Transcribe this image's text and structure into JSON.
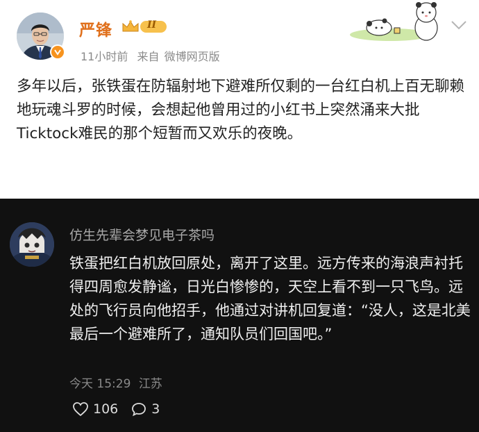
{
  "post": {
    "author": "严锋",
    "level_badge": "II",
    "time": "11小时前",
    "source_prefix": "来自",
    "source": "微博网页版",
    "text": "多年以后，张铁蛋在防辐射地下避难所仅剩的一台红白机上百无聊赖地玩魂斗罗的时候，会想起他曾用过的小红书上突然涌来大批Ticktock难民的那个短暂而又欢乐的夜晚。"
  },
  "comment": {
    "author": "仿生先辈会梦见电子茶吗",
    "text": "铁蛋把红白机放回原处，离开了这里。远方传来的海浪声衬托得四周愈发静谧，日光白惨惨的，天空上看不到一只飞鸟。远处的飞行员向他招手，他通过对讲机回复道：“没人，这是北美最后一个避难所了，通知队员们回国吧。”",
    "time": "今天 15:29",
    "location": "江苏",
    "likes": "106",
    "replies": "3"
  },
  "colors": {
    "author_orange": "#e0701c",
    "meta_gray": "#8a8a8a",
    "dark_bg": "#111111",
    "comment_text": "#efefef"
  },
  "icons": [
    "verified-badge-icon",
    "level-crown-icon",
    "chevron-down-icon",
    "heart-icon",
    "comment-bubble-icon"
  ]
}
